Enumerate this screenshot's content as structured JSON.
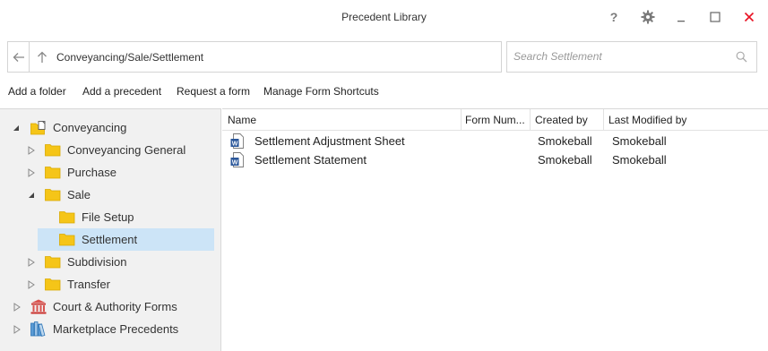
{
  "window": {
    "title": "Precedent Library",
    "help_icon": "help-icon",
    "settings_icon": "gear-icon",
    "minimize_icon": "minimize-icon",
    "maximize_icon": "maximize-icon",
    "close_icon": "close-icon",
    "close_color": "#e81123"
  },
  "address": {
    "path": "Conveyancing/Sale/Settlement",
    "back_icon": "back-arrow-icon",
    "up_icon": "up-arrow-icon"
  },
  "search": {
    "placeholder": "Search Settlement",
    "icon": "search-icon"
  },
  "toolbar": {
    "add_folder": "Add a folder",
    "add_precedent": "Add a precedent",
    "request_form": "Request a form",
    "manage_shortcuts": "Manage Form Shortcuts"
  },
  "tree": {
    "conveyancing": "Conveyancing",
    "conveyancing_general": "Conveyancing General",
    "purchase": "Purchase",
    "sale": "Sale",
    "file_setup": "File Setup",
    "settlement": "Settlement",
    "subdivision": "Subdivision",
    "transfer": "Transfer",
    "court_authority": "Court & Authority Forms",
    "marketplace": "Marketplace Precedents",
    "folder_color": "#f5c518",
    "selected_color": "#cce4f7"
  },
  "list": {
    "headers": {
      "name": "Name",
      "form_number": "Form Num...",
      "created_by": "Created by",
      "last_modified_by": "Last Modified by"
    },
    "rows": [
      {
        "name": "Settlement Adjustment Sheet",
        "form_number": "",
        "created_by": "Smokeball",
        "last_modified_by": "Smokeball",
        "icon": "word-document-icon"
      },
      {
        "name": "Settlement Statement",
        "form_number": "",
        "created_by": "Smokeball",
        "last_modified_by": "Smokeball",
        "icon": "word-document-icon"
      }
    ]
  }
}
